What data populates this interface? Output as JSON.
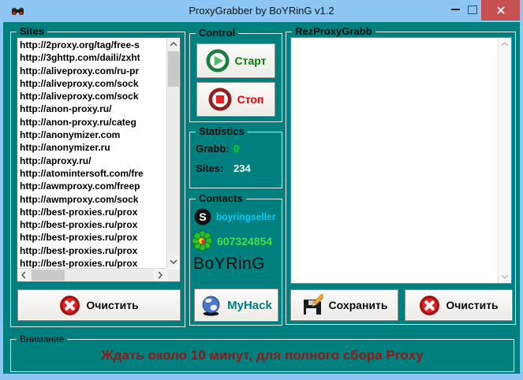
{
  "window": {
    "title": "ProxyGrabber by BoYRinG v1.2",
    "app_icon": "binoculars-icon",
    "controls": {
      "minimize": "minimize",
      "maximize": "maximize",
      "close": "close"
    }
  },
  "sites_panel": {
    "label": "Sites",
    "items": [
      "http://2proxy.org/tag/free-s",
      "http://3ghttp.com/daili/zxht",
      "http://aliveproxy.com/ru-pr",
      "http://aliveproxy.com/sock",
      "http://aliveproxy.com/sock",
      "http://anon-proxy.ru/",
      "http://anon-proxy.ru/categ",
      "http://anonymizer.com",
      "http://anonymizer.ru",
      "http://aproxy.ru/",
      "http://atomintersoft.com/fre",
      "http://awmproxy.com/freep",
      "http://awmproxy.com/sock",
      "http://best-proxies.ru/prox",
      "http://best-proxies.ru/prox",
      "http://best-proxies.ru/prox",
      "http://best-proxies.ru/prox",
      "http://best-proxies.ru/prox"
    ],
    "clear_button": "Очистить"
  },
  "control_panel": {
    "label": "Control",
    "start_button": "Старт",
    "stop_button": "Стоп"
  },
  "statistics_panel": {
    "label": "Statistics",
    "grabb_label": "Grabb:",
    "grabb_value": "0",
    "sites_label": "Sites:",
    "sites_value": "234"
  },
  "contacts_panel": {
    "label": "Contacts",
    "skype_name": "boyringseller",
    "icq_number": "607324854",
    "brand": "BoYRinG",
    "myhack_button": "MyHack"
  },
  "result_panel": {
    "label": "RezProxyGrabb",
    "content": "",
    "save_button": "Сохранить",
    "clear_button": "Очистить"
  },
  "warning_panel": {
    "label": "Внимание",
    "text": "Ждать около 10 минут, для полного сбора Proxy"
  },
  "icons": {
    "app": "binoculars-icon",
    "start": "play-circle-icon",
    "stop": "stop-circle-icon",
    "clear": "red-cross-circle-icon",
    "save": "floppy-pencil-icon",
    "skype": "skype-icon",
    "icq": "icq-flower-icon",
    "myhack": "globe-icon"
  },
  "colors": {
    "client_bg": "#007f7f",
    "titlebar_bg": "#8dc6f2",
    "close_button": "#c75050",
    "start_text": "#008000",
    "stop_text": "#ee0000",
    "grabb_value": "#00e000",
    "sites_value": "#ffffff",
    "skype_text": "#00ccff",
    "icq_text": "#44e044",
    "myhack_text": "#007d7d",
    "warning_text": "#971616",
    "focused_box_border": "#2f9bdb"
  }
}
